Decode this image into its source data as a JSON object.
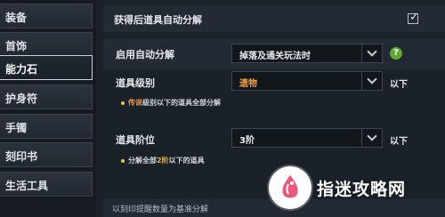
{
  "sidebar": {
    "items": [
      {
        "label": "装备"
      },
      {
        "label": "首饰"
      },
      {
        "label": "能力石",
        "active": true
      },
      {
        "label": "护身符"
      },
      {
        "label": "手镯"
      },
      {
        "label": "刻印书"
      },
      {
        "label": "生活工具"
      }
    ]
  },
  "settings": {
    "auto_decompose": {
      "label": "获得后道具自动分解",
      "checked": true
    },
    "enable": {
      "label": "启用自动分解",
      "value": "掉落及通关玩法时",
      "help": "?"
    },
    "grade": {
      "label": "道具级别",
      "value": "遗物",
      "suffix": "以下",
      "note_highlight": "传说",
      "note_rest": "级别以下的道具全部分解"
    },
    "tier": {
      "label": "道具阶位",
      "value": "3阶",
      "suffix": "以下",
      "note_prefix": "分解全部",
      "note_highlight": "2阶",
      "note_rest": "以下的道具"
    }
  },
  "footer": {
    "text": "以刻印提醒数量为基准分解"
  },
  "watermark": {
    "text": "指迷攻略网"
  },
  "colors": {
    "accent_orange": "#f59a3c",
    "help_green": "#5fa733",
    "dot_yellow": "#d8d43a"
  }
}
